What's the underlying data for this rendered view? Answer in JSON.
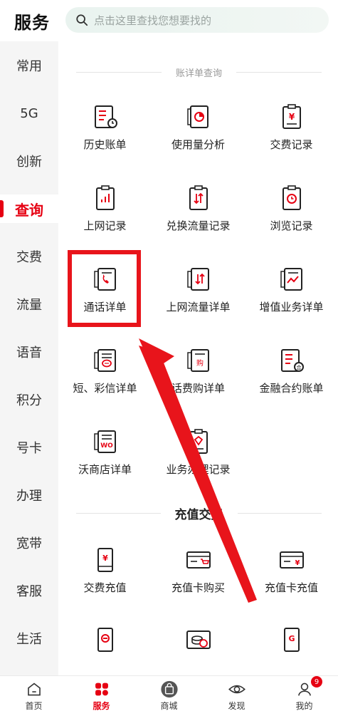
{
  "header": {
    "title": "服务",
    "search_placeholder": "点击这里查找您想要找的"
  },
  "sidebar": {
    "items": [
      {
        "label": "常用"
      },
      {
        "label": "5G"
      },
      {
        "label": "创新"
      },
      {
        "label": "查询",
        "active": true
      },
      {
        "label": "交费"
      },
      {
        "label": "流量"
      },
      {
        "label": "语音"
      },
      {
        "label": "积分"
      },
      {
        "label": "号卡"
      },
      {
        "label": "办理"
      },
      {
        "label": "宽带"
      },
      {
        "label": "客服"
      },
      {
        "label": "生活"
      }
    ]
  },
  "sections": {
    "bill": {
      "title": "账详单查询",
      "tiles": [
        {
          "label": "历史账单",
          "icon": "history-bill-icon"
        },
        {
          "label": "使用量分析",
          "icon": "usage-analysis-icon"
        },
        {
          "label": "交费记录",
          "icon": "payment-record-icon"
        },
        {
          "label": "上网记录",
          "icon": "internet-record-icon"
        },
        {
          "label": "兑换流量记录",
          "icon": "exchange-data-icon"
        },
        {
          "label": "浏览记录",
          "icon": "browse-record-icon"
        },
        {
          "label": "通话详单",
          "icon": "call-detail-icon"
        },
        {
          "label": "上网流量详单",
          "icon": "data-detail-icon"
        },
        {
          "label": "增值业务详单",
          "icon": "value-added-icon"
        },
        {
          "label": "短、彩信详单",
          "icon": "sms-detail-icon"
        },
        {
          "label": "话费购详单",
          "icon": "purchase-detail-icon"
        },
        {
          "label": "金融合约账单",
          "icon": "finance-contract-icon"
        },
        {
          "label": "沃商店详单",
          "icon": "wo-store-icon"
        },
        {
          "label": "业务办理记录",
          "icon": "service-record-icon"
        }
      ]
    },
    "recharge": {
      "title": "充值交费",
      "tiles": [
        {
          "label": "交费充值",
          "icon": "phone-recharge-icon"
        },
        {
          "label": "充值卡购买",
          "icon": "card-purchase-icon"
        },
        {
          "label": "充值卡充值",
          "icon": "card-recharge-icon"
        }
      ]
    }
  },
  "bottom_nav": {
    "items": [
      {
        "label": "首页",
        "icon": "home-icon"
      },
      {
        "label": "服务",
        "icon": "service-icon",
        "active": true
      },
      {
        "label": "商城",
        "icon": "mall-icon"
      },
      {
        "label": "发现",
        "icon": "discover-icon"
      },
      {
        "label": "我的",
        "icon": "profile-icon",
        "badge": "9"
      }
    ]
  },
  "colors": {
    "accent": "#e60012",
    "highlight_box": "#e8141b",
    "arrow": "#e8141b"
  }
}
